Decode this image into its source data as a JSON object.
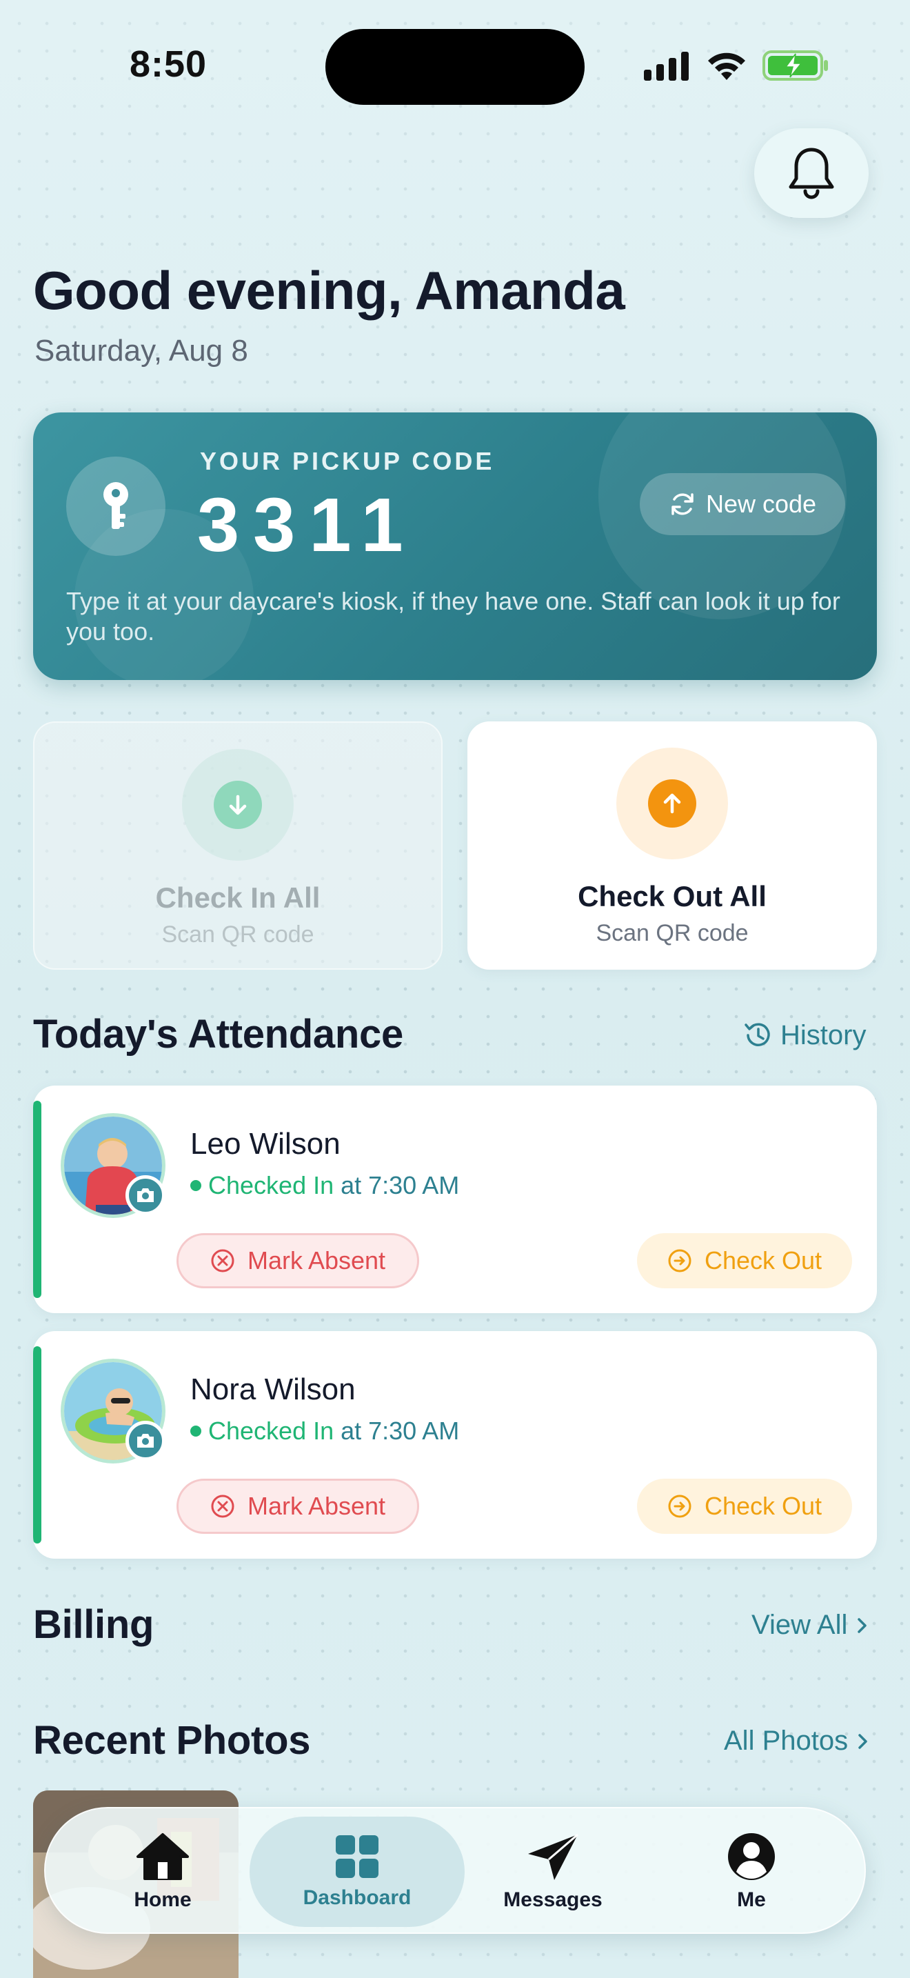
{
  "status_bar": {
    "time": "8:50"
  },
  "header": {
    "greeting": "Good evening, Amanda",
    "date": "Saturday, Aug 8"
  },
  "pickup": {
    "label": "YOUR PICKUP CODE",
    "code": "3311",
    "new_code_label": "New code",
    "help_text": "Type it at your daycare's kiosk, if they have one. Staff can look it up for you too."
  },
  "check_actions": {
    "check_in": {
      "title": "Check In All",
      "subtitle": "Scan QR code"
    },
    "check_out": {
      "title": "Check Out All",
      "subtitle": "Scan QR code"
    }
  },
  "attendance": {
    "title": "Today's Attendance",
    "history_label": "History",
    "children": [
      {
        "name": "Leo Wilson",
        "status": "Checked In",
        "time": "at 7:30 AM",
        "absent_label": "Mark Absent",
        "checkout_label": "Check Out"
      },
      {
        "name": "Nora Wilson",
        "status": "Checked In",
        "time": "at 7:30 AM",
        "absent_label": "Mark Absent",
        "checkout_label": "Check Out"
      }
    ]
  },
  "billing": {
    "title": "Billing",
    "link": "View All"
  },
  "photos": {
    "title": "Recent Photos",
    "link": "All Photos"
  },
  "tabbar": {
    "items": [
      {
        "label": "Home",
        "icon": "home-icon"
      },
      {
        "label": "Dashboard",
        "icon": "dashboard-icon"
      },
      {
        "label": "Messages",
        "icon": "paper-plane-icon"
      },
      {
        "label": "Me",
        "icon": "person-circle-icon"
      }
    ],
    "active": "Dashboard"
  },
  "colors": {
    "accent_teal": "#2d8090",
    "success_green": "#1fb574",
    "danger_red": "#e04b50",
    "warning_orange": "#f3940f"
  }
}
